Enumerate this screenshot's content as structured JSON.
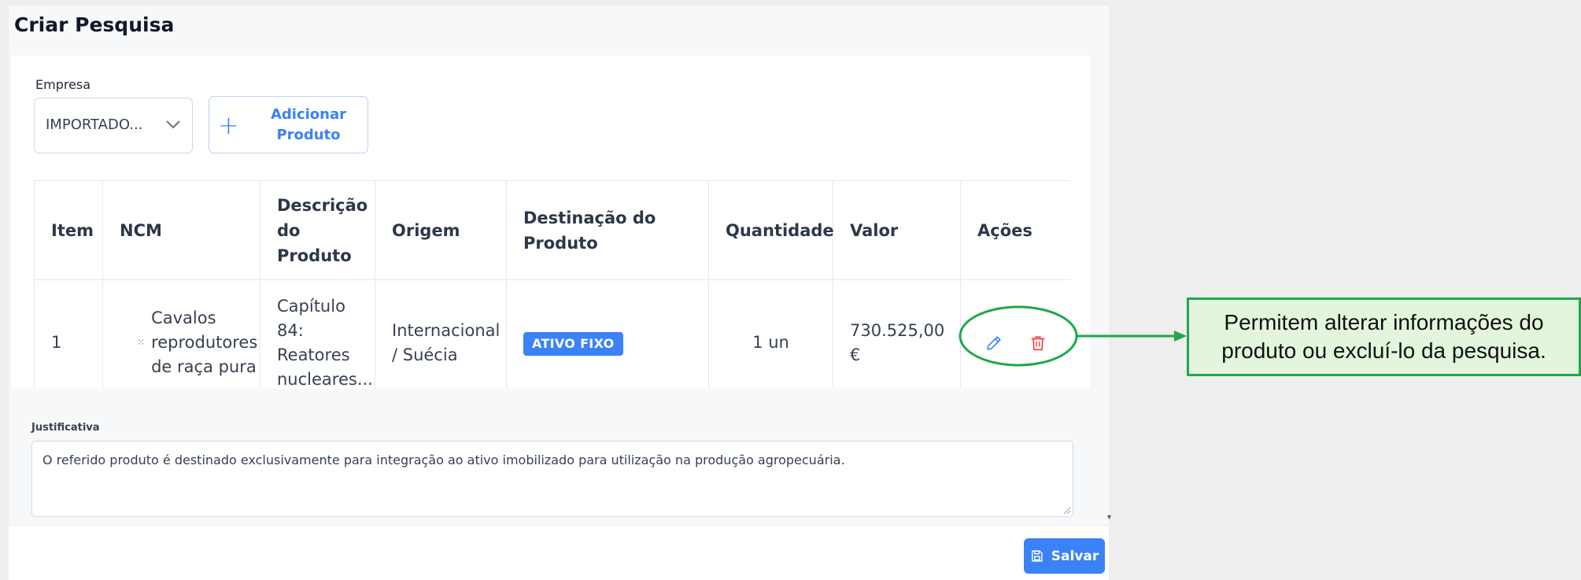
{
  "modal": {
    "title": "Criar Pesquisa"
  },
  "form": {
    "empresa_label": "Empresa",
    "empresa_value": "IMPORTADO...",
    "add_product_label": "Adicionar Produto"
  },
  "table": {
    "headers": [
      "Item",
      "NCM",
      "Descrição do Produto",
      "Origem",
      "Destinação do Produto",
      "Quantidade",
      "Valor",
      "Ações"
    ],
    "rows": [
      {
        "item": "1",
        "ncm": "Cavalos reprodutores de raça pura",
        "descricao": "Capítulo 84: Reatores nucleares...",
        "origem": "Internacional / Suécia",
        "destinacao": "ATIVO FIXO",
        "quantidade": "1 un",
        "valor": "730.525,00 €"
      }
    ]
  },
  "justificativa": {
    "label": "Justificativa",
    "value": "O referido produto é destinado exclusivamente para integração ao ativo imobilizado para utilização na produção agropecuária."
  },
  "footer": {
    "save_label": "Salvar"
  },
  "annotation": {
    "text": "Permitem alterar informações do produto ou excluí-lo da pesquisa."
  },
  "colors": {
    "primary": "#3b82f6",
    "danger": "#ef4444",
    "annotation_green": "#1ea84b",
    "annotation_bg": "#e3f5dc"
  }
}
